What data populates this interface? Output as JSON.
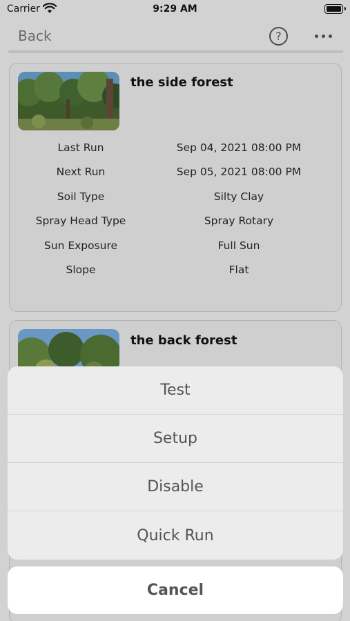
{
  "status_bar": {
    "carrier": "Carrier",
    "time": "9:29 AM"
  },
  "nav": {
    "back_label": "Back",
    "help_glyph": "?",
    "icons": [
      "help-icon",
      "more-icon"
    ]
  },
  "zones": [
    {
      "title": "the side forest",
      "details": [
        {
          "label": "Last Run",
          "value": "Sep 04, 2021 08:00 PM"
        },
        {
          "label": "Next Run",
          "value": "Sep 05, 2021 08:00 PM"
        },
        {
          "label": "Soil Type",
          "value": "Silty Clay"
        },
        {
          "label": "Spray Head Type",
          "value": "Spray Rotary"
        },
        {
          "label": "Sun Exposure",
          "value": "Full Sun"
        },
        {
          "label": "Slope",
          "value": "Flat"
        }
      ]
    },
    {
      "title": "the back forest"
    }
  ],
  "action_sheet": {
    "actions": [
      "Test",
      "Setup",
      "Disable",
      "Quick Run"
    ],
    "cancel_label": "Cancel"
  },
  "colors": {
    "background": "#d2d2d2",
    "sheet": "#ececec",
    "cancel": "#ffffff",
    "action_text": "#555555"
  }
}
